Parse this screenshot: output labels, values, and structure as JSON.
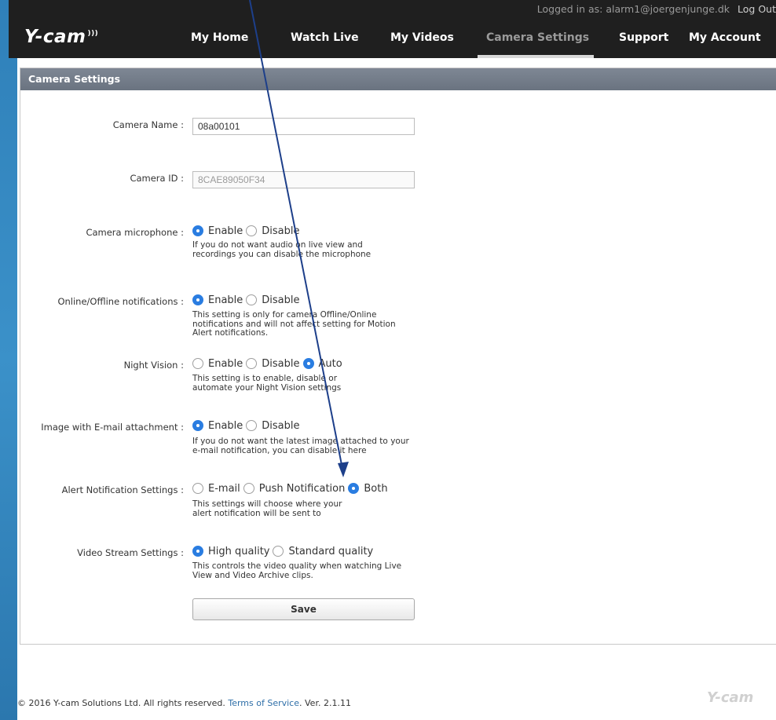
{
  "header": {
    "logged_in_text": "Logged in as: alarm1@joergenjunge.dk",
    "logout_label": "Log Out",
    "logo_text": "Y-cam"
  },
  "nav": {
    "items": [
      {
        "label": "My Home"
      },
      {
        "label": "Watch Live"
      },
      {
        "label": "My Videos"
      },
      {
        "label": "Camera Settings",
        "active": true
      },
      {
        "label": "Support"
      },
      {
        "label": "My Account"
      }
    ]
  },
  "panel": {
    "title": "Camera Settings"
  },
  "form": {
    "camera_name": {
      "label": "Camera Name :",
      "value": "08a00101"
    },
    "camera_id": {
      "label": "Camera ID :",
      "value": "8CAE89050F34"
    },
    "microphone": {
      "label": "Camera microphone :",
      "options": [
        "Enable",
        "Disable"
      ],
      "selected": "Enable",
      "help": "If you do not want audio on live view and recordings you can disable the microphone"
    },
    "online_notifications": {
      "label": "Online/Offline notifications :",
      "options": [
        "Enable",
        "Disable"
      ],
      "selected": "Enable",
      "help": "This setting is only for camera Offline/Online notifications and will not affect setting for Motion Alert notifications."
    },
    "night_vision": {
      "label": "Night Vision :",
      "options": [
        "Enable",
        "Disable",
        "Auto"
      ],
      "selected": "Auto",
      "help": "This setting is to enable, disable or automate your Night Vision settings"
    },
    "image_email": {
      "label": "Image with E-mail attachment :",
      "options": [
        "Enable",
        "Disable"
      ],
      "selected": "Enable",
      "help": "If you do not want the latest image attached to your e-mail notification, you can disable it here"
    },
    "alert_notification": {
      "label": "Alert Notification Settings :",
      "options": [
        "E-mail",
        "Push Notification",
        "Both"
      ],
      "selected": "Both",
      "help": "This settings will choose where your alert notification will be sent to"
    },
    "video_stream": {
      "label": "Video Stream Settings :",
      "options": [
        "High quality",
        "Standard quality"
      ],
      "selected": "High quality",
      "help": "This controls the video quality when watching Live View and Video Archive clips."
    },
    "save_label": "Save"
  },
  "footer": {
    "copyright": "© 2016 Y-cam Solutions Ltd. All rights reserved.",
    "terms_label": "Terms of Service",
    "version": ". Ver. 2.1.11",
    "logo_text": "Y-cam"
  },
  "colors": {
    "accent_radio": "#2a7de1",
    "annotation_arrow": "#1d3f8a",
    "topbar": "#1f1f1f"
  }
}
